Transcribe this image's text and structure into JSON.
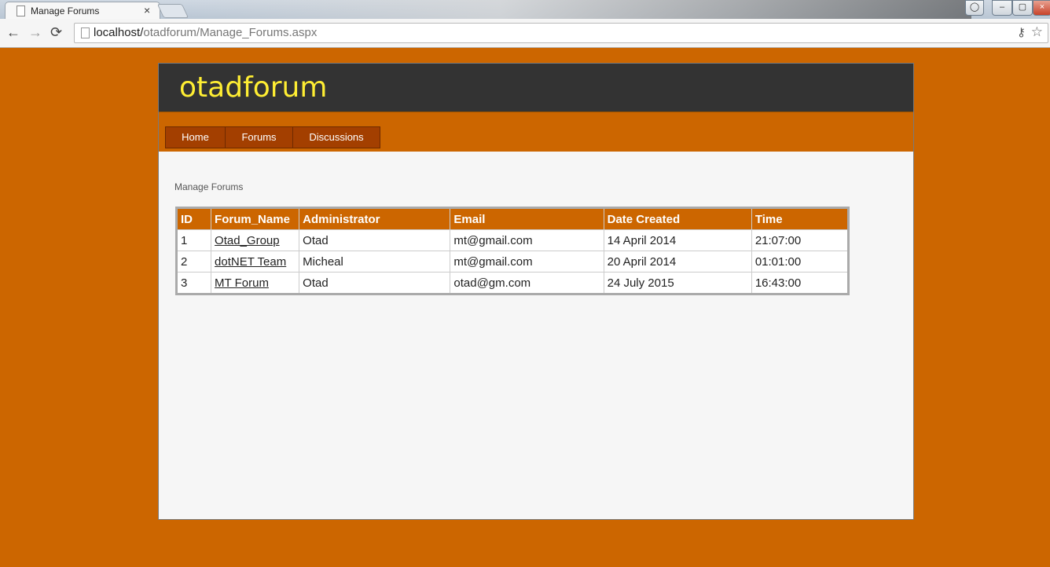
{
  "browser": {
    "tab_title": "Manage Forums",
    "tab_close": "×",
    "url_host": "localhost/",
    "url_path": "otadforum/Manage_Forums.aspx",
    "back_icon": "←",
    "forward_icon": "→",
    "reload_icon": "⟳",
    "star_icon": "☆",
    "key_icon": "⚷",
    "minimize": "–",
    "maximize": "▢",
    "close": "×"
  },
  "site": {
    "title": "otadforum",
    "colors": {
      "background": "#cc6600",
      "header": "#333333",
      "title": "#ffee33",
      "menu_item": "#a33f00"
    }
  },
  "menu": {
    "items": [
      {
        "label": "Home"
      },
      {
        "label": "Forums"
      },
      {
        "label": "Discussions"
      }
    ]
  },
  "main": {
    "heading": "Manage Forums",
    "table": {
      "headers": [
        "ID",
        "Forum_Name",
        "Administrator",
        "Email",
        "Date Created",
        "Time"
      ],
      "rows": [
        {
          "id": "1",
          "forum_name": "Otad_Group",
          "administrator": "Otad",
          "email": "mt@gmail.com",
          "date_created": "14 April 2014",
          "time": "21:07:00"
        },
        {
          "id": "2",
          "forum_name": "dotNET Team",
          "administrator": "Micheal",
          "email": "mt@gmail.com",
          "date_created": "20 April 2014",
          "time": "01:01:00"
        },
        {
          "id": "3",
          "forum_name": "MT Forum",
          "administrator": "Otad",
          "email": "otad@gm.com",
          "date_created": "24 July 2015",
          "time": "16:43:00"
        }
      ]
    }
  }
}
